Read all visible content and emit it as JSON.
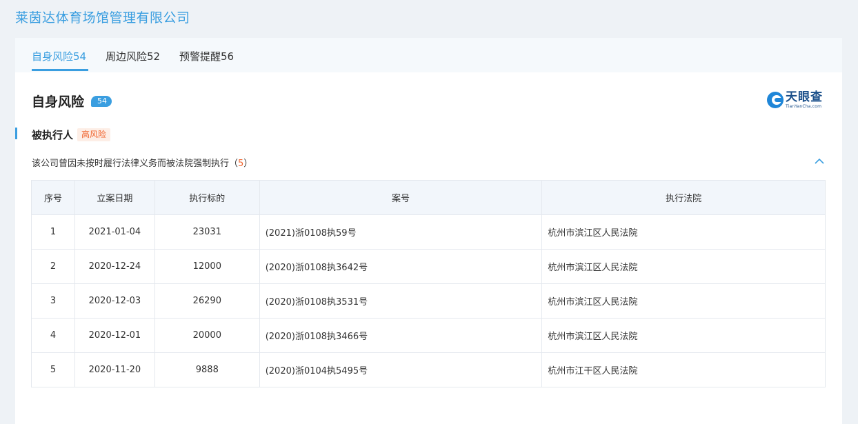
{
  "company": {
    "name": "莱茵达体育场馆管理有限公司"
  },
  "tabs": [
    {
      "label": "自身风险54",
      "active": true
    },
    {
      "label": "周边风险52",
      "active": false
    },
    {
      "label": "预警提醒56",
      "active": false
    }
  ],
  "section": {
    "title": "自身风险",
    "count": "54"
  },
  "logo": {
    "cn": "天眼查",
    "en": "TianYanCha.com"
  },
  "subsection": {
    "title": "被执行人",
    "tag": "高风险"
  },
  "description": {
    "text": "该公司曾因未按时履行法律义务而被法院强制执行（",
    "count": "5",
    "suffix": "）"
  },
  "table": {
    "headers": [
      "序号",
      "立案日期",
      "执行标的",
      "案号",
      "执行法院"
    ],
    "rows": [
      [
        "1",
        "2021-01-04",
        "23031",
        "(2021)浙0108执59号",
        "杭州市滨江区人民法院"
      ],
      [
        "2",
        "2020-12-24",
        "12000",
        "(2020)浙0108执3642号",
        "杭州市滨江区人民法院"
      ],
      [
        "3",
        "2020-12-03",
        "26290",
        "(2020)浙0108执3531号",
        "杭州市滨江区人民法院"
      ],
      [
        "4",
        "2020-12-01",
        "20000",
        "(2020)浙0108执3466号",
        "杭州市滨江区人民法院"
      ],
      [
        "5",
        "2020-11-20",
        "9888",
        "(2020)浙0104执5495号",
        "杭州市江干区人民法院"
      ]
    ]
  },
  "colors": {
    "accent": "#3a9ee0",
    "risk": "#f0652f",
    "brand": "#1a4f8a"
  },
  "icons": {
    "collapse": "chevron-up-icon",
    "logo": "tianyancha-logo-icon"
  }
}
